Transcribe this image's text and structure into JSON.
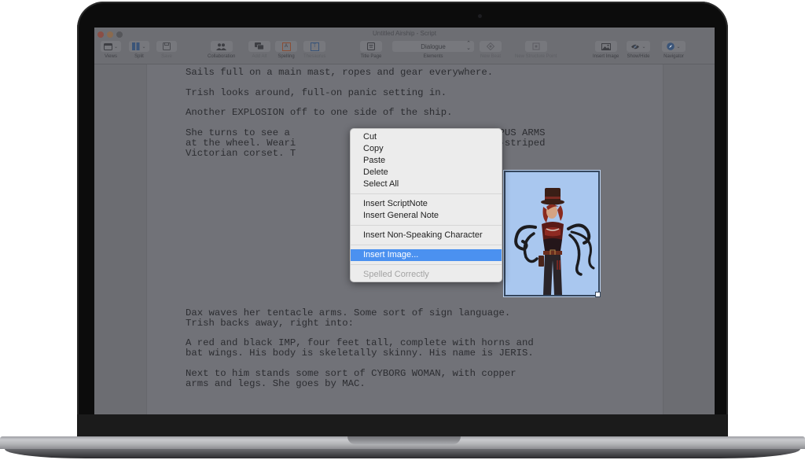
{
  "window": {
    "title": "Untitled Airship - Script"
  },
  "toolbar": {
    "views": {
      "label": "Views",
      "icon": "window-layout-icon"
    },
    "split": {
      "label": "Split",
      "icon": "split-columns-icon"
    },
    "save": {
      "label": "Save",
      "icon": "save-icon"
    },
    "collaboration": {
      "label": "Collaboration",
      "icon": "people-icon"
    },
    "add_alt": {
      "label": "Add Alt",
      "icon": "speech-bubbles-icon"
    },
    "spelling": {
      "label": "Spelling",
      "icon": "spelling-icon",
      "glyph": "A"
    },
    "thesaurus": {
      "label": "Thesaurus",
      "icon": "thesaurus-icon",
      "glyph": "T"
    },
    "title_page": {
      "label": "Title Page",
      "icon": "title-page-icon"
    },
    "elements": {
      "label": "Elements",
      "value": "Dialogue"
    },
    "new_beat": {
      "label": "New Beat",
      "icon": "beat-diamond-icon"
    },
    "new_structure_point": {
      "label": "New Structure Point",
      "icon": "structure-point-icon"
    },
    "insert_image": {
      "label": "Insert Image",
      "icon": "image-icon"
    },
    "show_hide": {
      "label": "Show/Hide",
      "icon": "eye-slash-icon"
    },
    "navigator": {
      "label": "Navigator",
      "icon": "compass-icon"
    }
  },
  "script": {
    "paragraphs": [
      "Sails full on a main mast, ropes and gear everywhere.",
      "Trish looks around, full-on panic setting in.",
      "Another EXPLOSION off to one side of the ship.",
      "She turns to see a                             TH OCTOPUS ARMS\nat the wheel. Weari                              a pin-striped\nVictorian corset. T",
      "Dax waves her tentacle arms. Some sort of sign language.\nTrish backs away, right into:",
      "A red and black IMP, four feet tall, complete with horns and\nbat wings. His body is skeletally skinny. His name is JERIS.",
      "Next to him stands some sort of CYBORG WOMAN, with copper\narms and legs. She goes by MAC."
    ],
    "image": {
      "description": "Steampunk woman with top hat, red corset and black octopus tentacle arms",
      "background": "#a9c7ef"
    }
  },
  "context_menu": {
    "groups": [
      [
        {
          "label": "Cut",
          "state": "enabled"
        },
        {
          "label": "Copy",
          "state": "enabled"
        },
        {
          "label": "Paste",
          "state": "enabled"
        },
        {
          "label": "Delete",
          "state": "enabled"
        },
        {
          "label": "Select All",
          "state": "enabled"
        }
      ],
      [
        {
          "label": "Insert ScriptNote",
          "state": "enabled"
        },
        {
          "label": "Insert General Note",
          "state": "enabled"
        }
      ],
      [
        {
          "label": "Insert Non-Speaking Character",
          "state": "enabled"
        }
      ],
      [
        {
          "label": "Insert Image...",
          "state": "highlighted"
        }
      ],
      [
        {
          "label": "Spelled Correctly",
          "state": "disabled"
        }
      ]
    ],
    "highlight_color": "#4b91f0"
  }
}
